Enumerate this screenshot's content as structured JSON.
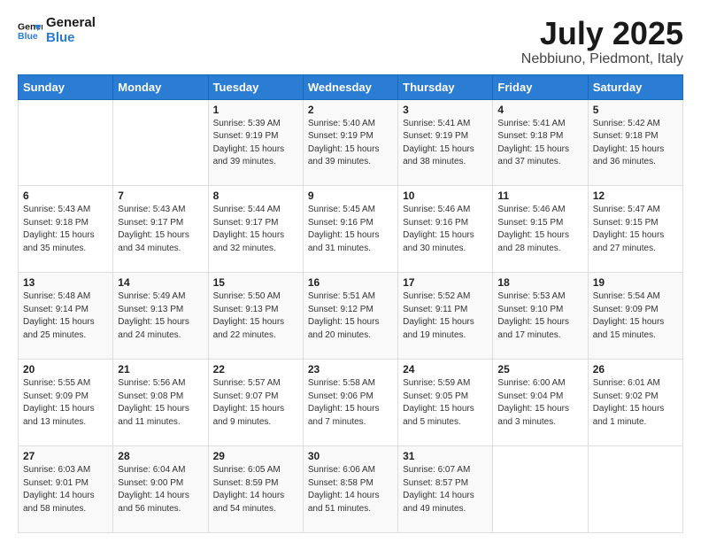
{
  "logo": {
    "line1": "General",
    "line2": "Blue"
  },
  "title": "July 2025",
  "subtitle": "Nebbiuno, Piedmont, Italy",
  "days_of_week": [
    "Sunday",
    "Monday",
    "Tuesday",
    "Wednesday",
    "Thursday",
    "Friday",
    "Saturday"
  ],
  "weeks": [
    [
      {
        "day": "",
        "info": ""
      },
      {
        "day": "",
        "info": ""
      },
      {
        "day": "1",
        "info": "Sunrise: 5:39 AM\nSunset: 9:19 PM\nDaylight: 15 hours and 39 minutes."
      },
      {
        "day": "2",
        "info": "Sunrise: 5:40 AM\nSunset: 9:19 PM\nDaylight: 15 hours and 39 minutes."
      },
      {
        "day": "3",
        "info": "Sunrise: 5:41 AM\nSunset: 9:19 PM\nDaylight: 15 hours and 38 minutes."
      },
      {
        "day": "4",
        "info": "Sunrise: 5:41 AM\nSunset: 9:18 PM\nDaylight: 15 hours and 37 minutes."
      },
      {
        "day": "5",
        "info": "Sunrise: 5:42 AM\nSunset: 9:18 PM\nDaylight: 15 hours and 36 minutes."
      }
    ],
    [
      {
        "day": "6",
        "info": "Sunrise: 5:43 AM\nSunset: 9:18 PM\nDaylight: 15 hours and 35 minutes."
      },
      {
        "day": "7",
        "info": "Sunrise: 5:43 AM\nSunset: 9:17 PM\nDaylight: 15 hours and 34 minutes."
      },
      {
        "day": "8",
        "info": "Sunrise: 5:44 AM\nSunset: 9:17 PM\nDaylight: 15 hours and 32 minutes."
      },
      {
        "day": "9",
        "info": "Sunrise: 5:45 AM\nSunset: 9:16 PM\nDaylight: 15 hours and 31 minutes."
      },
      {
        "day": "10",
        "info": "Sunrise: 5:46 AM\nSunset: 9:16 PM\nDaylight: 15 hours and 30 minutes."
      },
      {
        "day": "11",
        "info": "Sunrise: 5:46 AM\nSunset: 9:15 PM\nDaylight: 15 hours and 28 minutes."
      },
      {
        "day": "12",
        "info": "Sunrise: 5:47 AM\nSunset: 9:15 PM\nDaylight: 15 hours and 27 minutes."
      }
    ],
    [
      {
        "day": "13",
        "info": "Sunrise: 5:48 AM\nSunset: 9:14 PM\nDaylight: 15 hours and 25 minutes."
      },
      {
        "day": "14",
        "info": "Sunrise: 5:49 AM\nSunset: 9:13 PM\nDaylight: 15 hours and 24 minutes."
      },
      {
        "day": "15",
        "info": "Sunrise: 5:50 AM\nSunset: 9:13 PM\nDaylight: 15 hours and 22 minutes."
      },
      {
        "day": "16",
        "info": "Sunrise: 5:51 AM\nSunset: 9:12 PM\nDaylight: 15 hours and 20 minutes."
      },
      {
        "day": "17",
        "info": "Sunrise: 5:52 AM\nSunset: 9:11 PM\nDaylight: 15 hours and 19 minutes."
      },
      {
        "day": "18",
        "info": "Sunrise: 5:53 AM\nSunset: 9:10 PM\nDaylight: 15 hours and 17 minutes."
      },
      {
        "day": "19",
        "info": "Sunrise: 5:54 AM\nSunset: 9:09 PM\nDaylight: 15 hours and 15 minutes."
      }
    ],
    [
      {
        "day": "20",
        "info": "Sunrise: 5:55 AM\nSunset: 9:09 PM\nDaylight: 15 hours and 13 minutes."
      },
      {
        "day": "21",
        "info": "Sunrise: 5:56 AM\nSunset: 9:08 PM\nDaylight: 15 hours and 11 minutes."
      },
      {
        "day": "22",
        "info": "Sunrise: 5:57 AM\nSunset: 9:07 PM\nDaylight: 15 hours and 9 minutes."
      },
      {
        "day": "23",
        "info": "Sunrise: 5:58 AM\nSunset: 9:06 PM\nDaylight: 15 hours and 7 minutes."
      },
      {
        "day": "24",
        "info": "Sunrise: 5:59 AM\nSunset: 9:05 PM\nDaylight: 15 hours and 5 minutes."
      },
      {
        "day": "25",
        "info": "Sunrise: 6:00 AM\nSunset: 9:04 PM\nDaylight: 15 hours and 3 minutes."
      },
      {
        "day": "26",
        "info": "Sunrise: 6:01 AM\nSunset: 9:02 PM\nDaylight: 15 hours and 1 minute."
      }
    ],
    [
      {
        "day": "27",
        "info": "Sunrise: 6:03 AM\nSunset: 9:01 PM\nDaylight: 14 hours and 58 minutes."
      },
      {
        "day": "28",
        "info": "Sunrise: 6:04 AM\nSunset: 9:00 PM\nDaylight: 14 hours and 56 minutes."
      },
      {
        "day": "29",
        "info": "Sunrise: 6:05 AM\nSunset: 8:59 PM\nDaylight: 14 hours and 54 minutes."
      },
      {
        "day": "30",
        "info": "Sunrise: 6:06 AM\nSunset: 8:58 PM\nDaylight: 14 hours and 51 minutes."
      },
      {
        "day": "31",
        "info": "Sunrise: 6:07 AM\nSunset: 8:57 PM\nDaylight: 14 hours and 49 minutes."
      },
      {
        "day": "",
        "info": ""
      },
      {
        "day": "",
        "info": ""
      }
    ]
  ]
}
